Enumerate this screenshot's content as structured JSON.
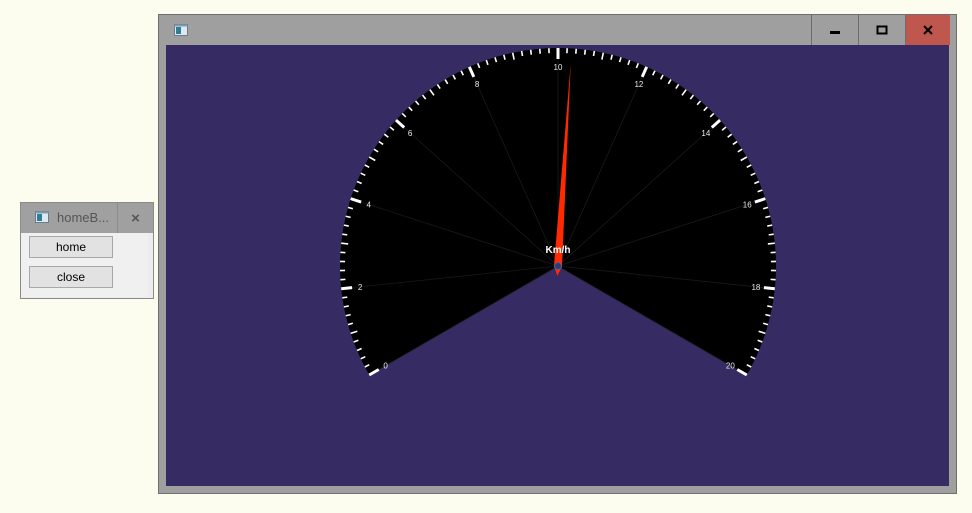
{
  "small_window": {
    "title": "homeB...",
    "buttons": {
      "home_label": "home",
      "close_label": "close"
    },
    "close_glyph": "×",
    "icon": "app-window-icon"
  },
  "main_window": {
    "icon": "app-window-icon",
    "controls": [
      "minimize-icon",
      "maximize-icon",
      "close-icon"
    ],
    "close_color": "#c0574f",
    "background": "#372b63"
  },
  "gauge": {
    "unit": "Km/h",
    "min": 0,
    "max": 20,
    "labels": [
      "0",
      "2",
      "4",
      "6",
      "8",
      "10",
      "12",
      "14",
      "16",
      "18",
      "20"
    ],
    "value": 10.3,
    "start_angle_deg": 210,
    "end_angle_deg": -30,
    "needle_color": "#ff2a00",
    "face_color": "#000000",
    "tick_color": "#ffffff"
  }
}
